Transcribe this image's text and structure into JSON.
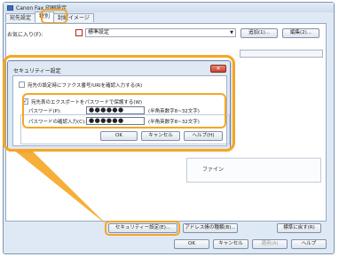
{
  "window": {
    "title": "Canon Fax 印刷設定"
  },
  "tabs": [
    "宛先設定",
    "特別",
    "封緘イメージ"
  ],
  "favorites": {
    "label": "お気に入り(F):",
    "value": "標準設定",
    "add_button": "追加(1)...",
    "edit_button": "編集(2)..."
  },
  "security_dialog": {
    "title": "セキュリティー設定",
    "close_label": "✕",
    "option1_label": "宛先の設定時にファクス番号/URIを確認入力する(R)",
    "option2_label": "宛先表のエクスポートをパスワードで保護する(W)",
    "password_label": "パスワード(P):",
    "password_value": "●●●●●●",
    "password_hint": "(半角英数字8~32文字)",
    "confirm_label": "パスワードの確認入力(C):",
    "confirm_value": "●●●●●●",
    "confirm_hint": "(半角英数字8~32文字)",
    "ok_button": "OK",
    "cancel_button": "キャンセル",
    "help_button": "ヘルプ(H)"
  },
  "background": {
    "fine_label": "ファイン"
  },
  "bottom": {
    "security_button": "セキュリティー設定(E)...",
    "address_type_button": "アドレス帳の種類(B)...",
    "restore_button": "標準に戻す(R)",
    "ok_button": "OK",
    "cancel_button": "キャンセル",
    "apply_button": "適用(A)",
    "help_button": "ヘルプ"
  },
  "colors": {
    "highlight": "#f5a623"
  }
}
